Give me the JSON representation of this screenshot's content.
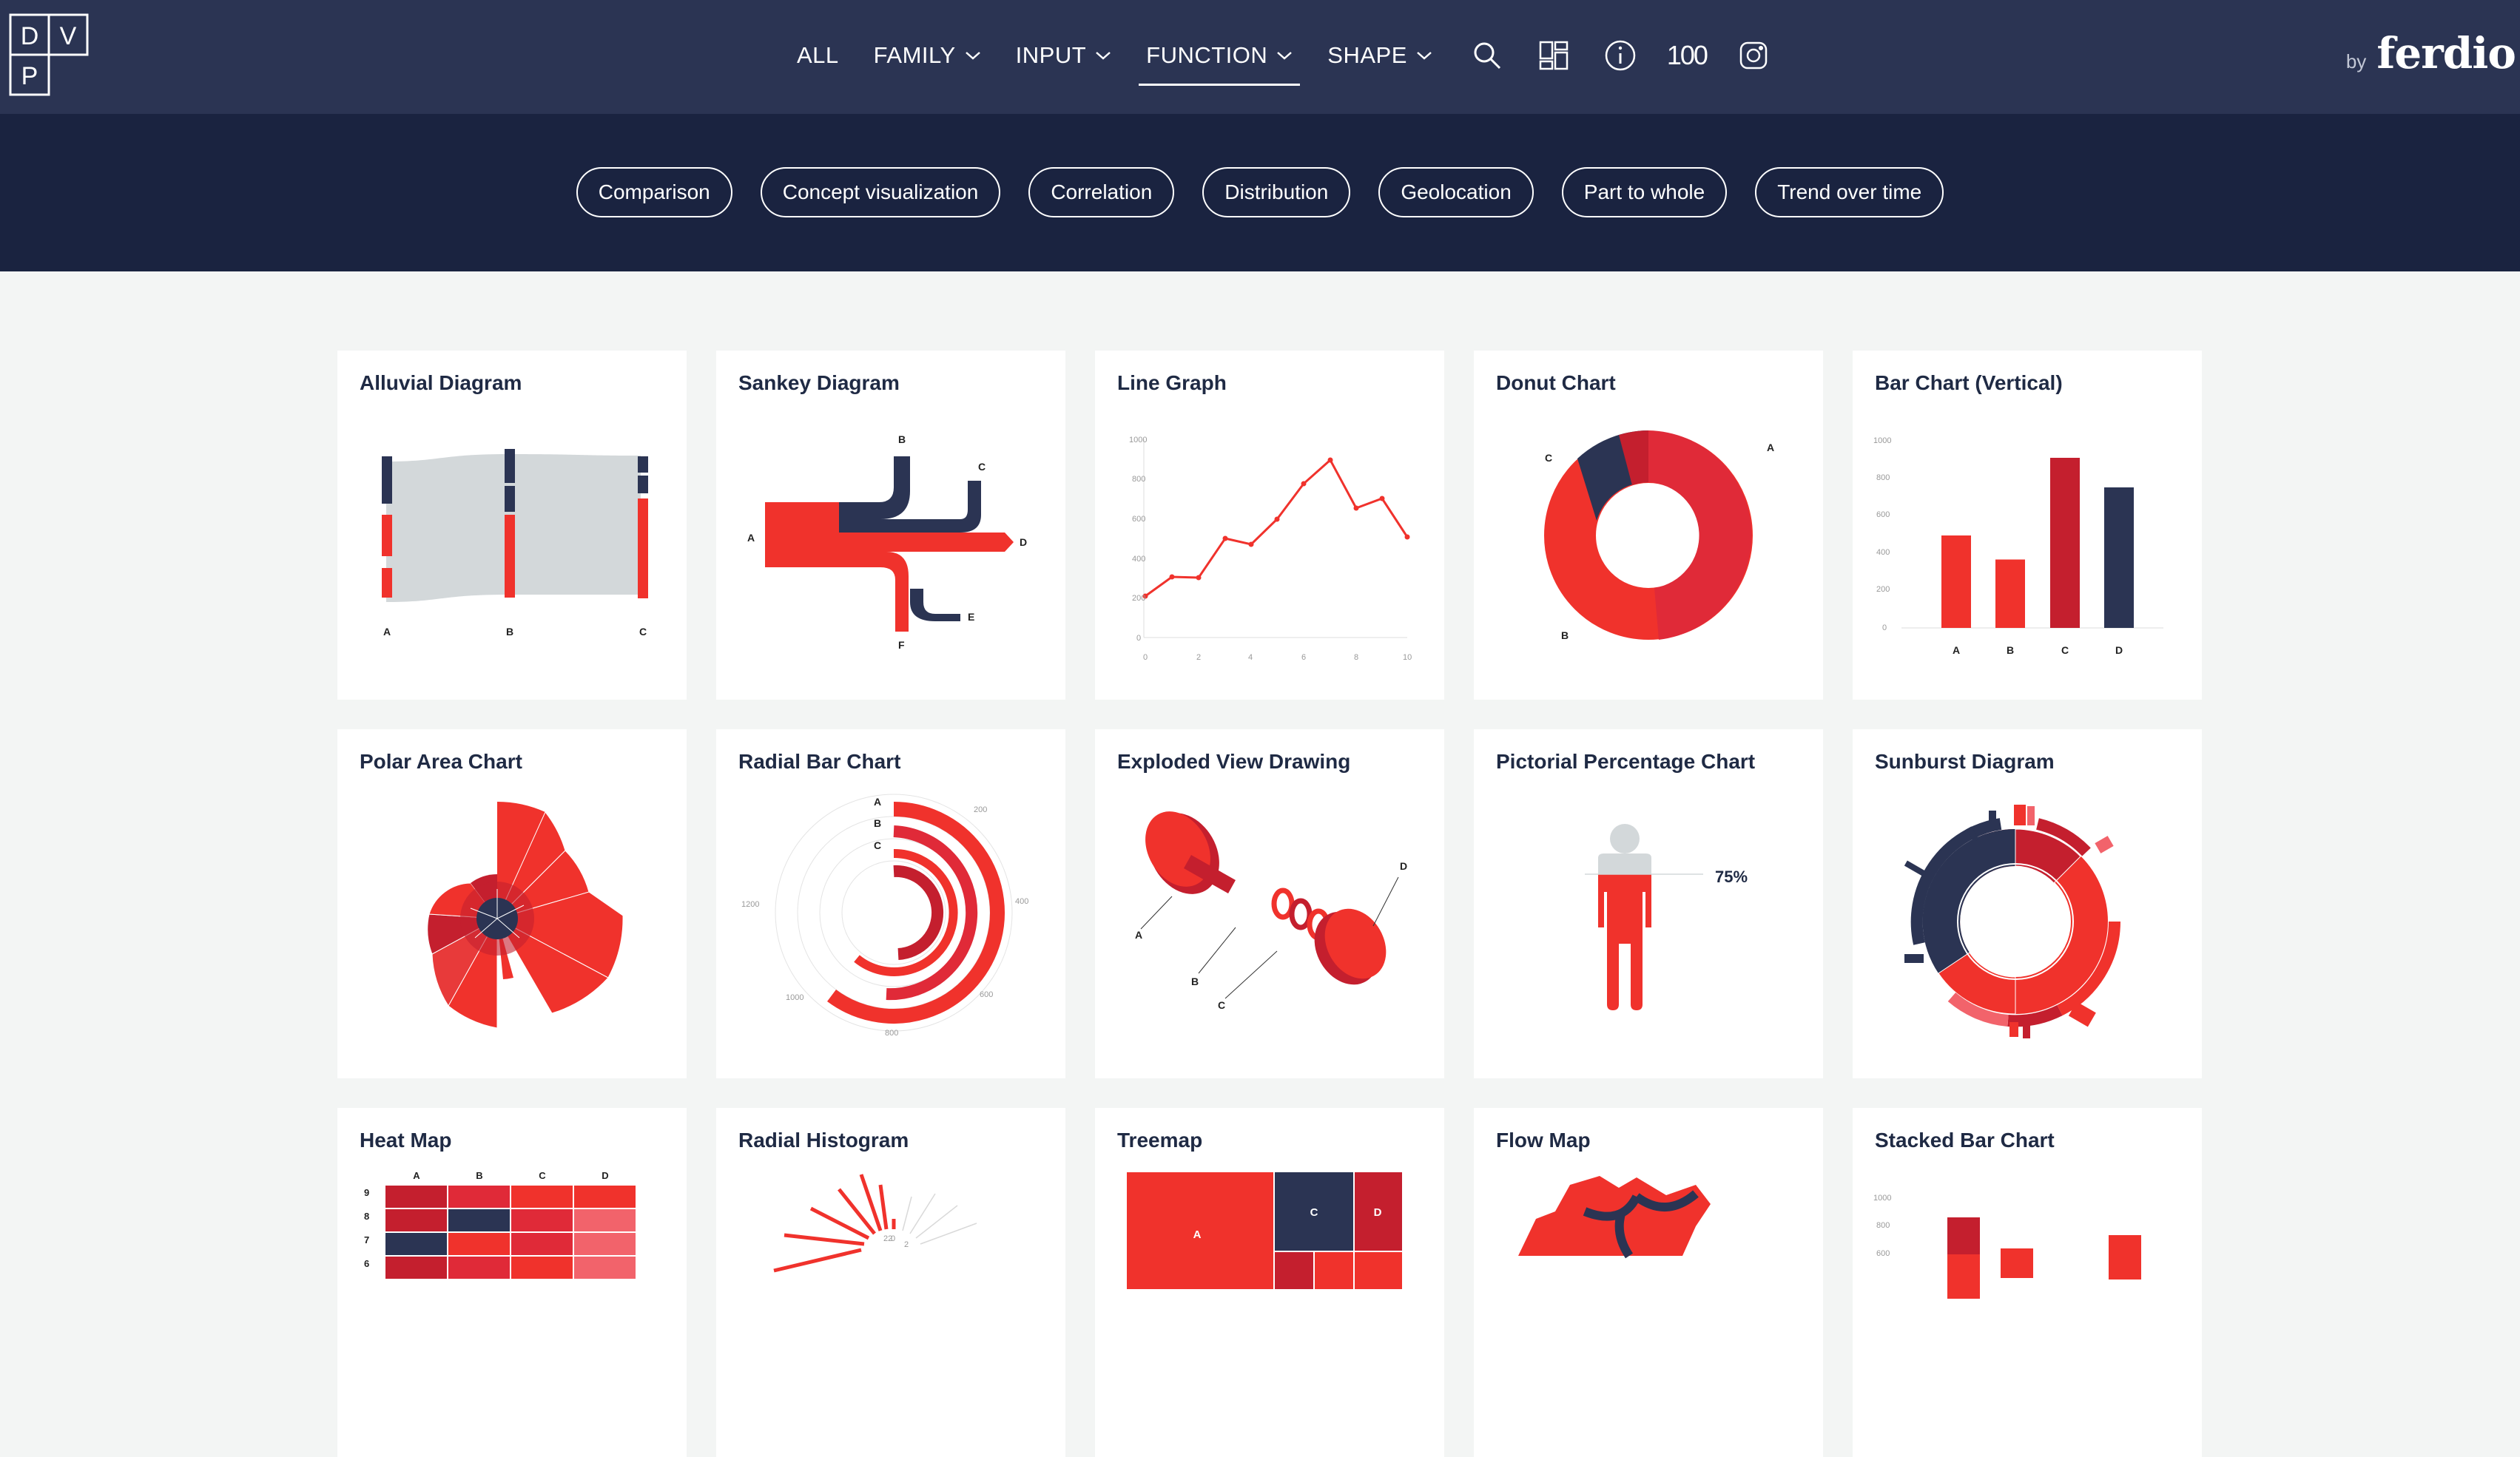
{
  "logo": {
    "letters": [
      "D",
      "V",
      "P"
    ]
  },
  "nav": {
    "items": [
      {
        "label": "ALL",
        "dropdown": false,
        "active": false
      },
      {
        "label": "FAMILY",
        "dropdown": true,
        "active": false
      },
      {
        "label": "INPUT",
        "dropdown": true,
        "active": false
      },
      {
        "label": "FUNCTION",
        "dropdown": true,
        "active": true
      },
      {
        "label": "SHAPE",
        "dropdown": true,
        "active": false
      }
    ],
    "icons": [
      "search-icon",
      "grid-layout-icon",
      "info-icon",
      "100",
      "instagram-icon"
    ]
  },
  "byline": {
    "prefix": "by",
    "brand": "ferdio"
  },
  "filters": [
    "Comparison",
    "Concept visualization",
    "Correlation",
    "Distribution",
    "Geolocation",
    "Part to whole",
    "Trend over time"
  ],
  "cards": [
    "Alluvial Diagram",
    "Sankey Diagram",
    "Line Graph",
    "Donut Chart",
    "Bar Chart (Vertical)",
    "Polar Area Chart",
    "Radial Bar Chart",
    "Exploded View Drawing",
    "Pictorial Percentage Chart",
    "Sunburst Diagram",
    "Heat Map",
    "Radial Histogram",
    "Treemap",
    "Flow Map",
    "Stacked Bar Chart"
  ],
  "thumbs": {
    "alluvial_labels": [
      "A",
      "B",
      "C"
    ],
    "sankey_labels": [
      "A",
      "B",
      "C",
      "D",
      "E",
      "F"
    ],
    "line_x_ticks": [
      "0",
      "2",
      "4",
      "6",
      "8",
      "10"
    ],
    "line_y_ticks": [
      "0",
      "200",
      "400",
      "600",
      "800",
      "1000"
    ],
    "donut_labels": [
      "A",
      "B",
      "C"
    ],
    "bar_categories": [
      "A",
      "B",
      "C",
      "D"
    ],
    "bar_values": [
      500,
      370,
      920,
      760
    ],
    "bar_y_ticks": [
      "0",
      "200",
      "400",
      "600",
      "800",
      "1000"
    ],
    "radial_labels": [
      "A",
      "B",
      "C"
    ],
    "radial_ticks": [
      "200",
      "400",
      "600",
      "800",
      "1000",
      "1200"
    ],
    "exploded_labels": [
      "A",
      "B",
      "C",
      "D"
    ],
    "pictorial_value": "75%",
    "heat_cols": [
      "A",
      "B",
      "C",
      "D"
    ],
    "heat_rows": [
      "9",
      "8",
      "7",
      "6"
    ],
    "treemap_labels": [
      "A",
      "C",
      "D"
    ],
    "stacked_y_ticks": [
      "1000",
      "800",
      "600"
    ]
  }
}
